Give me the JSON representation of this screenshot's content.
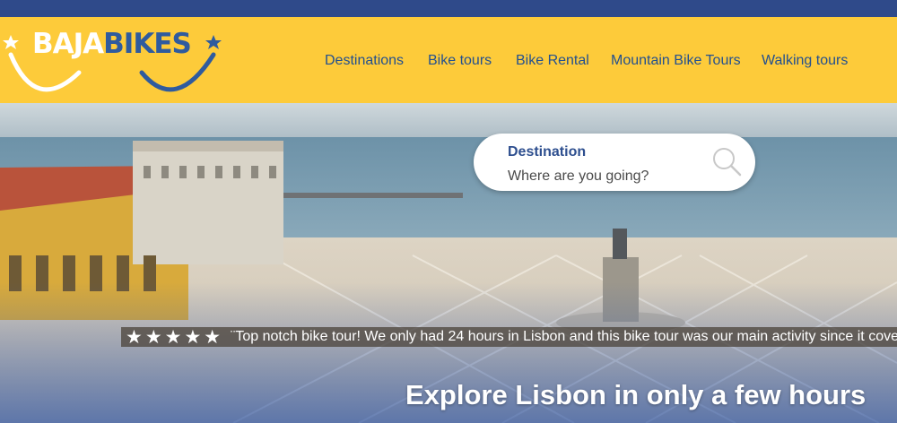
{
  "brand": {
    "logo_part1": "BAJA",
    "logo_part2": "BIKES",
    "colors": {
      "top_bar": "#2f4a8a",
      "header": "#fdcb3a",
      "nav_text": "#23508f",
      "logo_blue": "#2f5b9e"
    }
  },
  "nav": {
    "items": [
      {
        "label": "Destinations"
      },
      {
        "label": "Bike tours"
      },
      {
        "label": "Bike Rental"
      },
      {
        "label": "Mountain Bike Tours"
      },
      {
        "label": "Walking tours"
      }
    ]
  },
  "search": {
    "title": "Destination",
    "placeholder": "Where are you going?",
    "icon": "search-icon"
  },
  "review": {
    "stars": "★★★★★",
    "rating": 5,
    "text": "¨Top notch bike tour! We only had 24 hours in Lisbon and this bike tour was our main activity since it cove"
  },
  "hero": {
    "tagline": "Explore Lisbon in only a few hours"
  }
}
